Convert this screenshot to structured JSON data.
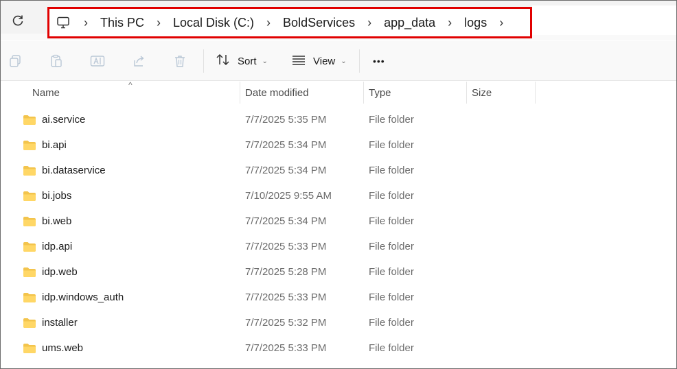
{
  "address_bar": {
    "refresh_icon": "refresh-icon",
    "root_icon": "monitor-icon",
    "crumbs": [
      "This PC",
      "Local Disk (C:)",
      "BoldServices",
      "app_data",
      "logs"
    ],
    "highlight_color": "#e10000"
  },
  "toolbar": {
    "icons": [
      "copy-icon",
      "paste-icon",
      "rename-icon",
      "share-icon",
      "delete-icon"
    ],
    "sort_label": "Sort",
    "view_label": "View",
    "more_label": "•••"
  },
  "columns": {
    "name": "Name",
    "date": "Date modified",
    "type": "Type",
    "size": "Size"
  },
  "files": [
    {
      "name": "ai.service",
      "date": "7/7/2025 5:35 PM",
      "type": "File folder"
    },
    {
      "name": "bi.api",
      "date": "7/7/2025 5:34 PM",
      "type": "File folder"
    },
    {
      "name": "bi.dataservice",
      "date": "7/7/2025 5:34 PM",
      "type": "File folder"
    },
    {
      "name": "bi.jobs",
      "date": "7/10/2025 9:55 AM",
      "type": "File folder"
    },
    {
      "name": "bi.web",
      "date": "7/7/2025 5:34 PM",
      "type": "File folder"
    },
    {
      "name": "idp.api",
      "date": "7/7/2025 5:33 PM",
      "type": "File folder"
    },
    {
      "name": "idp.web",
      "date": "7/7/2025 5:28 PM",
      "type": "File folder"
    },
    {
      "name": "idp.windows_auth",
      "date": "7/7/2025 5:33 PM",
      "type": "File folder"
    },
    {
      "name": "installer",
      "date": "7/7/2025 5:32 PM",
      "type": "File folder"
    },
    {
      "name": "ums.web",
      "date": "7/7/2025 5:33 PM",
      "type": "File folder"
    }
  ]
}
